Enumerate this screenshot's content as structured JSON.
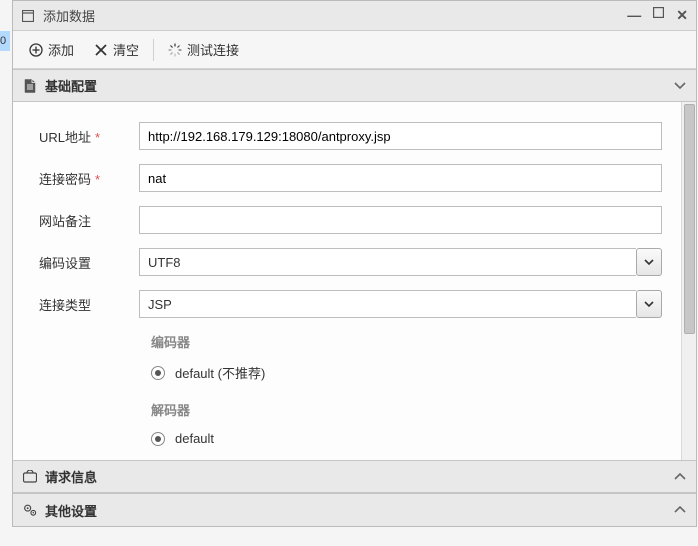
{
  "strip_text": "0",
  "window": {
    "title": "添加数据"
  },
  "toolbar": {
    "add": "添加",
    "clear": "清空",
    "test": "测试连接"
  },
  "panels": {
    "basic": "基础配置",
    "request": "请求信息",
    "other": "其他设置"
  },
  "form": {
    "url": {
      "label": "URL地址",
      "value": "http://192.168.179.129:18080/antproxy.jsp"
    },
    "password": {
      "label": "连接密码",
      "value": "nat"
    },
    "remark": {
      "label": "网站备注",
      "value": ""
    },
    "encoding": {
      "label": "编码设置",
      "value": "UTF8"
    },
    "type": {
      "label": "连接类型",
      "value": "JSP"
    }
  },
  "encoder": {
    "title": "编码器",
    "option": "default (不推荐)"
  },
  "decoder": {
    "title": "解码器",
    "option": "default"
  }
}
